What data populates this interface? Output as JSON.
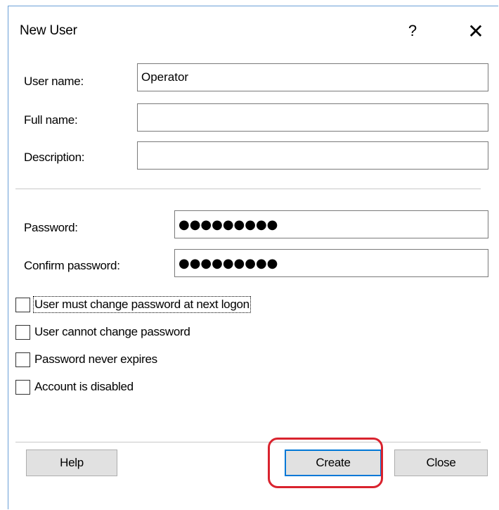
{
  "window": {
    "title": "New User",
    "help_glyph": "?",
    "close_glyph": "✕"
  },
  "form": {
    "username_label": "User name:",
    "username_value": "Operator",
    "fullname_label": "Full name:",
    "fullname_value": "",
    "description_label": "Description:",
    "description_value": "",
    "password_label": "Password:",
    "password_value": "●●●●●●●●●",
    "confirm_label": "Confirm password:",
    "confirm_value": "●●●●●●●●●"
  },
  "options": [
    {
      "label": "User must change password at next logon",
      "checked": false,
      "focused": true
    },
    {
      "label": "User cannot change password",
      "checked": false
    },
    {
      "label": "Password never expires",
      "checked": false
    },
    {
      "label": "Account is disabled",
      "checked": false
    }
  ],
  "buttons": {
    "help": "Help",
    "create": "Create",
    "close": "Close"
  },
  "colors": {
    "window_border": "#6a9fd6",
    "default_button_border": "#0078d7",
    "highlight_ring": "#d9232e",
    "button_face": "#e1e1e1"
  }
}
